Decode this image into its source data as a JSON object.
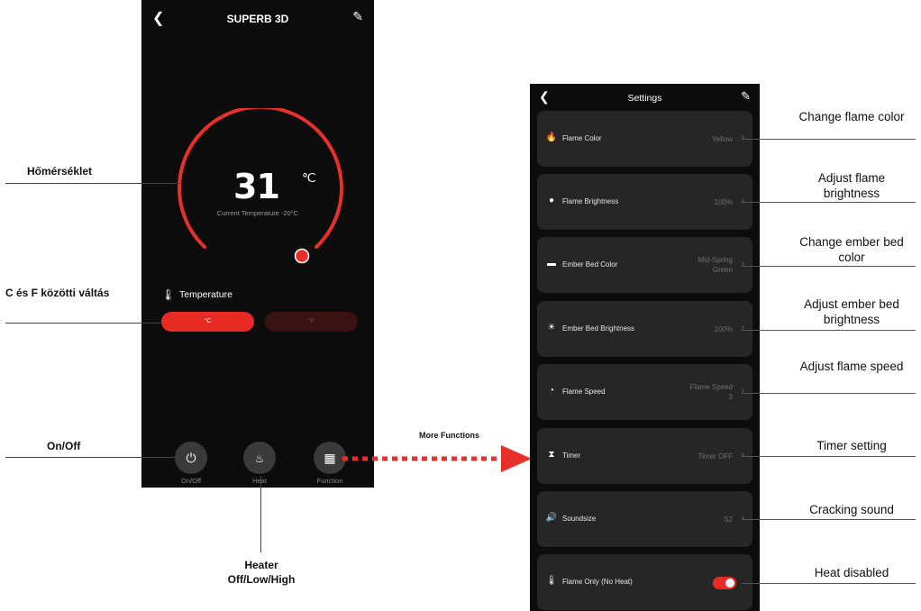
{
  "left_phone": {
    "title": "SUPERB 3D",
    "temperature_value": "31",
    "temperature_unit": "℃",
    "current_temperature": "Current Temperature -20°C",
    "temperature_label": "Temperature",
    "unit_c": "°C",
    "unit_f": "°F",
    "buttons": [
      {
        "label": "On/Off",
        "icon": "power-icon"
      },
      {
        "label": "Heat",
        "icon": "heat-icon"
      },
      {
        "label": "Function",
        "icon": "grid-icon"
      }
    ]
  },
  "annotations_left": {
    "temperature": "Hőmérséklet",
    "unit_switch": "C és F közötti váltás",
    "onoff": "On/Off",
    "heater_line1": "Heater",
    "heater_line2": "Off/Low/High",
    "more_functions": "More Functions"
  },
  "settings_phone": {
    "title": "Settings",
    "items": [
      {
        "name": "Flame Color",
        "value": "Yellow",
        "icon": "flame-icon"
      },
      {
        "name": "Flame Brightness",
        "value": "100%",
        "icon": "bulb-icon"
      },
      {
        "name": "Ember Bed Color",
        "value": "Mid-Spring Green",
        "icon": "ember-icon"
      },
      {
        "name": "Ember Bed Brightness",
        "value": "100%",
        "icon": "sun-icon"
      },
      {
        "name": "Flame Speed",
        "value": "Flame Speed 3",
        "icon": "speed-icon"
      },
      {
        "name": "Timer",
        "value": "Timer OFF",
        "icon": "hourglass-icon"
      },
      {
        "name": "Soundsize",
        "value": "S2",
        "icon": "speaker-icon"
      },
      {
        "name": "Flame Only (No Heat)",
        "value": "",
        "icon": "flame-only-icon",
        "toggle_on": true
      }
    ]
  },
  "annotations_right": [
    "Change flame color",
    "Adjust flame brightness",
    "Change ember bed color",
    "Adjust ember bed brightness",
    "Adjust flame speed",
    "Timer setting",
    "Cracking sound",
    "Heat disabled"
  ],
  "colors": {
    "accent": "#e82a24",
    "phone_bg": "#0c0c0c",
    "card_bg": "#262626"
  }
}
